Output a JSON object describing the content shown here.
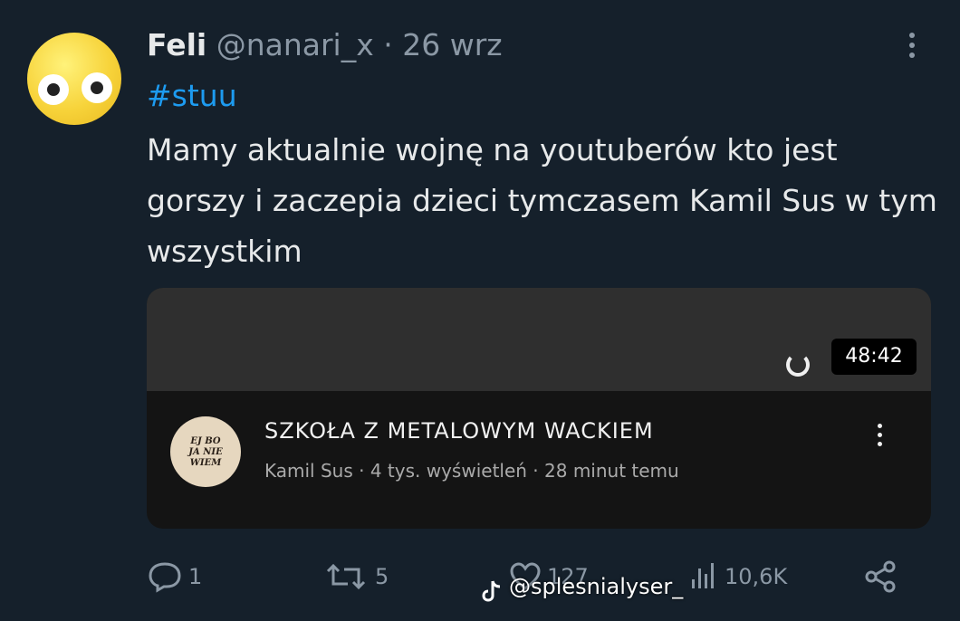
{
  "tweet": {
    "author_name": "Feli",
    "handle": "@nanari_x",
    "separator": "·",
    "date": "26 wrz",
    "hashtag": "#stuu",
    "text": "Mamy aktualnie wojnę na youtuberów kto jest gorszy i zaczepia dzieci tymczasem Kamil Sus w tym wszystkim"
  },
  "video_card": {
    "duration": "48:42",
    "title": "SZKOŁA Z METALOWYM WACKIEM",
    "meta": "Kamil Sus · 4 tys. wyświetleń · 28 minut temu",
    "channel_avatar_text": [
      "EJ BO",
      "JA NIE",
      "WIEM"
    ]
  },
  "actions": {
    "replies": "1",
    "reposts": "5",
    "likes": "127",
    "views": "10,6K"
  },
  "watermark": {
    "text": "@splesnialyser_"
  },
  "icons": [
    "more-vertical-icon",
    "loading-spinner-icon",
    "reply-icon",
    "repost-icon",
    "like-icon",
    "views-icon",
    "share-icon",
    "tiktok-icon"
  ],
  "colors": {
    "background": "#15202b",
    "text_primary": "#e7e9ea",
    "text_secondary": "#8b98a5",
    "hashtag": "#1d9bf0",
    "card_bg": "#141414",
    "card_preview": "#2f2f2f"
  }
}
